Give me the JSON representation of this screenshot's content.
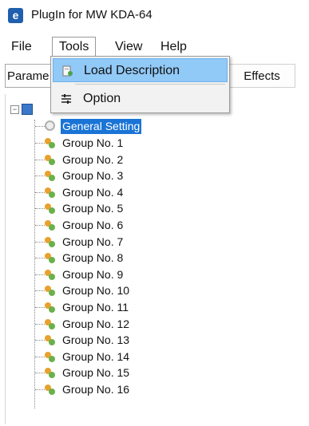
{
  "window": {
    "title": "PlugIn for MW KDA-64"
  },
  "menubar": {
    "items": [
      "File",
      "Tools",
      "View",
      "Help"
    ]
  },
  "toolbar": {
    "param_label": "Parame",
    "effects_label": "Effects"
  },
  "tools_menu": {
    "items": [
      {
        "label": "Load Description",
        "icon": "document-load-icon"
      },
      {
        "label": "Option",
        "icon": "list-settings-icon"
      }
    ]
  },
  "tree": {
    "general": "General Setting",
    "groups": [
      "Group No. 1",
      "Group No. 2",
      "Group No. 3",
      "Group No. 4",
      "Group No. 5",
      "Group No. 6",
      "Group No. 7",
      "Group No. 8",
      "Group No. 9",
      "Group No. 10",
      "Group No. 11",
      "Group No. 12",
      "Group No. 13",
      "Group No. 14",
      "Group No. 15",
      "Group No. 16"
    ]
  },
  "colors": {
    "selection": "#1a74d6",
    "menu_highlight": "#91c9f7"
  }
}
